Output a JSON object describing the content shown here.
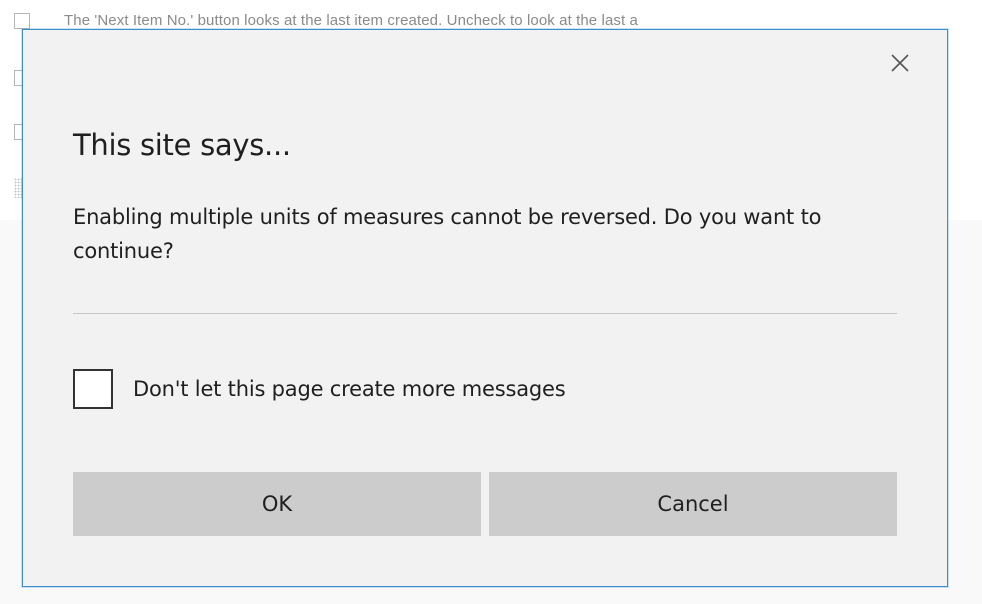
{
  "background": {
    "rows": [
      {
        "text": "The 'Next Item No.' button looks at the last item created. Uncheck to look at the last a"
      }
    ]
  },
  "dialog": {
    "title": "This site says...",
    "message": "Enabling multiple units of measures cannot be reversed.  Do you want to continue?",
    "suppress_checkbox": {
      "label": "Don't let this page create more messages",
      "checked": false
    },
    "ok_label": "OK",
    "cancel_label": "Cancel",
    "close_icon": "close-icon",
    "colors": {
      "border": "#3c8fc7",
      "background": "#f2f2f2",
      "button": "#cccccc"
    }
  }
}
